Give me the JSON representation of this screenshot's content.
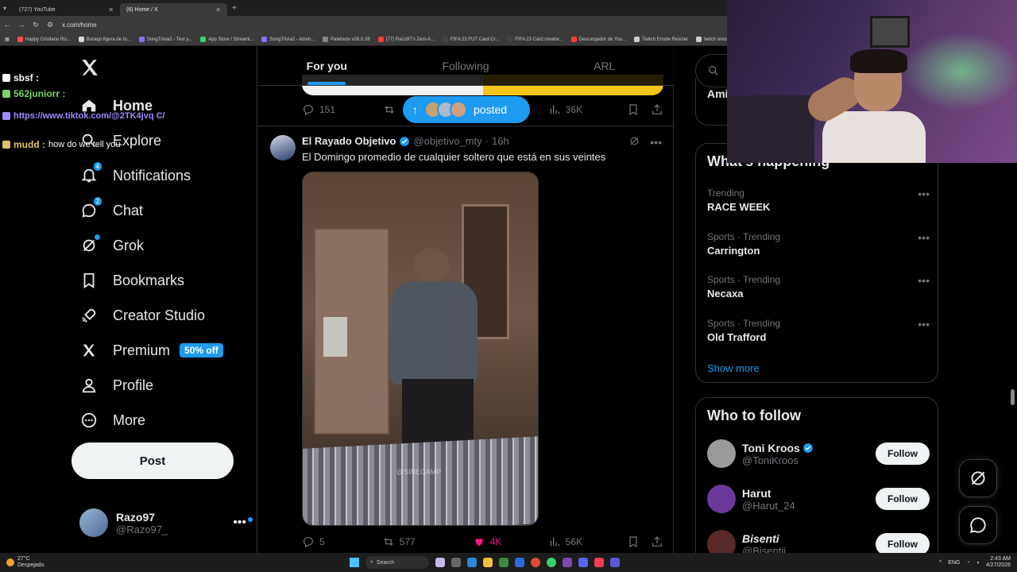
{
  "browser": {
    "tabs": [
      {
        "title": "(727) YouTube",
        "active": false
      },
      {
        "title": "(6) Home / X",
        "active": true
      }
    ],
    "url": "x.com/home",
    "bookmarks": [
      {
        "label": "Happy Cristiano Ro...",
        "color": "#ff4d4d"
      },
      {
        "label": "Buraqo figura de to...",
        "color": "#d8d8d8"
      },
      {
        "label": "SongTrivia2 - Test y...",
        "color": "#8b6cff"
      },
      {
        "label": "App Store / Streami...",
        "color": "#3ad06a"
      },
      {
        "label": "SongTrivia2 - Advin...",
        "color": "#8b6cff"
      },
      {
        "label": "Paletools v26.0.28",
        "color": "#888888"
      },
      {
        "label": "(77) Razo97's Zest-A...",
        "color": "#ff3b3b"
      },
      {
        "label": "FIFA 23 FUT Card Cr...",
        "color": "#444444"
      },
      {
        "label": "FIFA 23 Card creator...",
        "color": "#444444"
      },
      {
        "label": "Descargador de You...",
        "color": "#ff3b3b"
      },
      {
        "label": "Twitch Emote Resizer",
        "color": "#cccccc"
      },
      {
        "label": "twitch emote re",
        "color": "#cccccc"
      }
    ]
  },
  "chat": [
    {
      "user": "sbsf :",
      "msg": "",
      "user_color": "#ffffff"
    },
    {
      "user": "562juniorr :",
      "msg": "",
      "user_color": "#7cd36b"
    },
    {
      "user": "",
      "msg": "https://www.tiktok.com/@2TK4jvq C/",
      "user_color": "#9b8cff"
    },
    {
      "user": "mudd :",
      "msg": "how do we tell you",
      "user_color": "#d9c36b"
    }
  ],
  "nav": {
    "items": [
      {
        "label": "Home",
        "icon": "home-icon"
      },
      {
        "label": "Explore",
        "icon": "search-icon"
      },
      {
        "label": "Notifications",
        "icon": "bell-icon",
        "badge": "4"
      },
      {
        "label": "Chat",
        "icon": "chat-icon",
        "badge": "2"
      },
      {
        "label": "Grok",
        "icon": "grok-icon"
      },
      {
        "label": "Bookmarks",
        "icon": "bookmark-icon"
      },
      {
        "label": "Creator Studio",
        "icon": "rocket-icon"
      },
      {
        "label": "Premium",
        "icon": "x-icon",
        "pill": "50% off"
      },
      {
        "label": "Profile",
        "icon": "person-icon"
      },
      {
        "label": "More",
        "icon": "more-circle-icon"
      }
    ],
    "post_label": "Post",
    "account": {
      "name": "Razo97",
      "handle": "@Razo97_"
    }
  },
  "feed": {
    "tabs": [
      "For you",
      "Following",
      "ARL"
    ],
    "active_tab": "For you",
    "prev_post": {
      "replies": "151",
      "views": "36K"
    },
    "posted_pill": "posted",
    "tweet": {
      "name": "El Rayado Objetivo",
      "handle": "@objetivo_mty",
      "time": "16h",
      "text": "El Domingo promedio de cualquier soltero que está en sus veintes",
      "watermark": "@SINECAMP",
      "replies": "5",
      "reposts": "577",
      "likes": "4K",
      "views": "56K"
    }
  },
  "sidebar": {
    "search_placeholder": "Se",
    "premium_partial": "Ami",
    "whats_happening_title": "What's happening",
    "trends": [
      {
        "meta": "Trending",
        "name": "RACE WEEK"
      },
      {
        "meta": "Sports · Trending",
        "name": "Carrington"
      },
      {
        "meta": "Sports · Trending",
        "name": "Necaxa"
      },
      {
        "meta": "Sports · Trending",
        "name": "Old Trafford"
      }
    ],
    "show_more": "Show more",
    "who_to_follow_title": "Who to follow",
    "follow_label": "Follow",
    "suggestions": [
      {
        "name": "Toni Kroos",
        "handle": "@ToniKroos",
        "verified": true,
        "color": "#9a9a9a"
      },
      {
        "name": "Harut",
        "handle": "@Harut_24",
        "verified": false,
        "color": "#6a3a9a"
      },
      {
        "name": "Bisenti",
        "handle": "@Bisentii",
        "verified": false,
        "color": "#5a2a2a"
      }
    ]
  },
  "taskbar": {
    "temp": "27°C",
    "condition": "Despejado",
    "search": "Search",
    "lang": "ENG",
    "time": "2:43 AM",
    "date": "4/27/2026"
  },
  "colors": {
    "accent": "#1d9bf0",
    "like": "#f91880",
    "bg": "#000000"
  }
}
